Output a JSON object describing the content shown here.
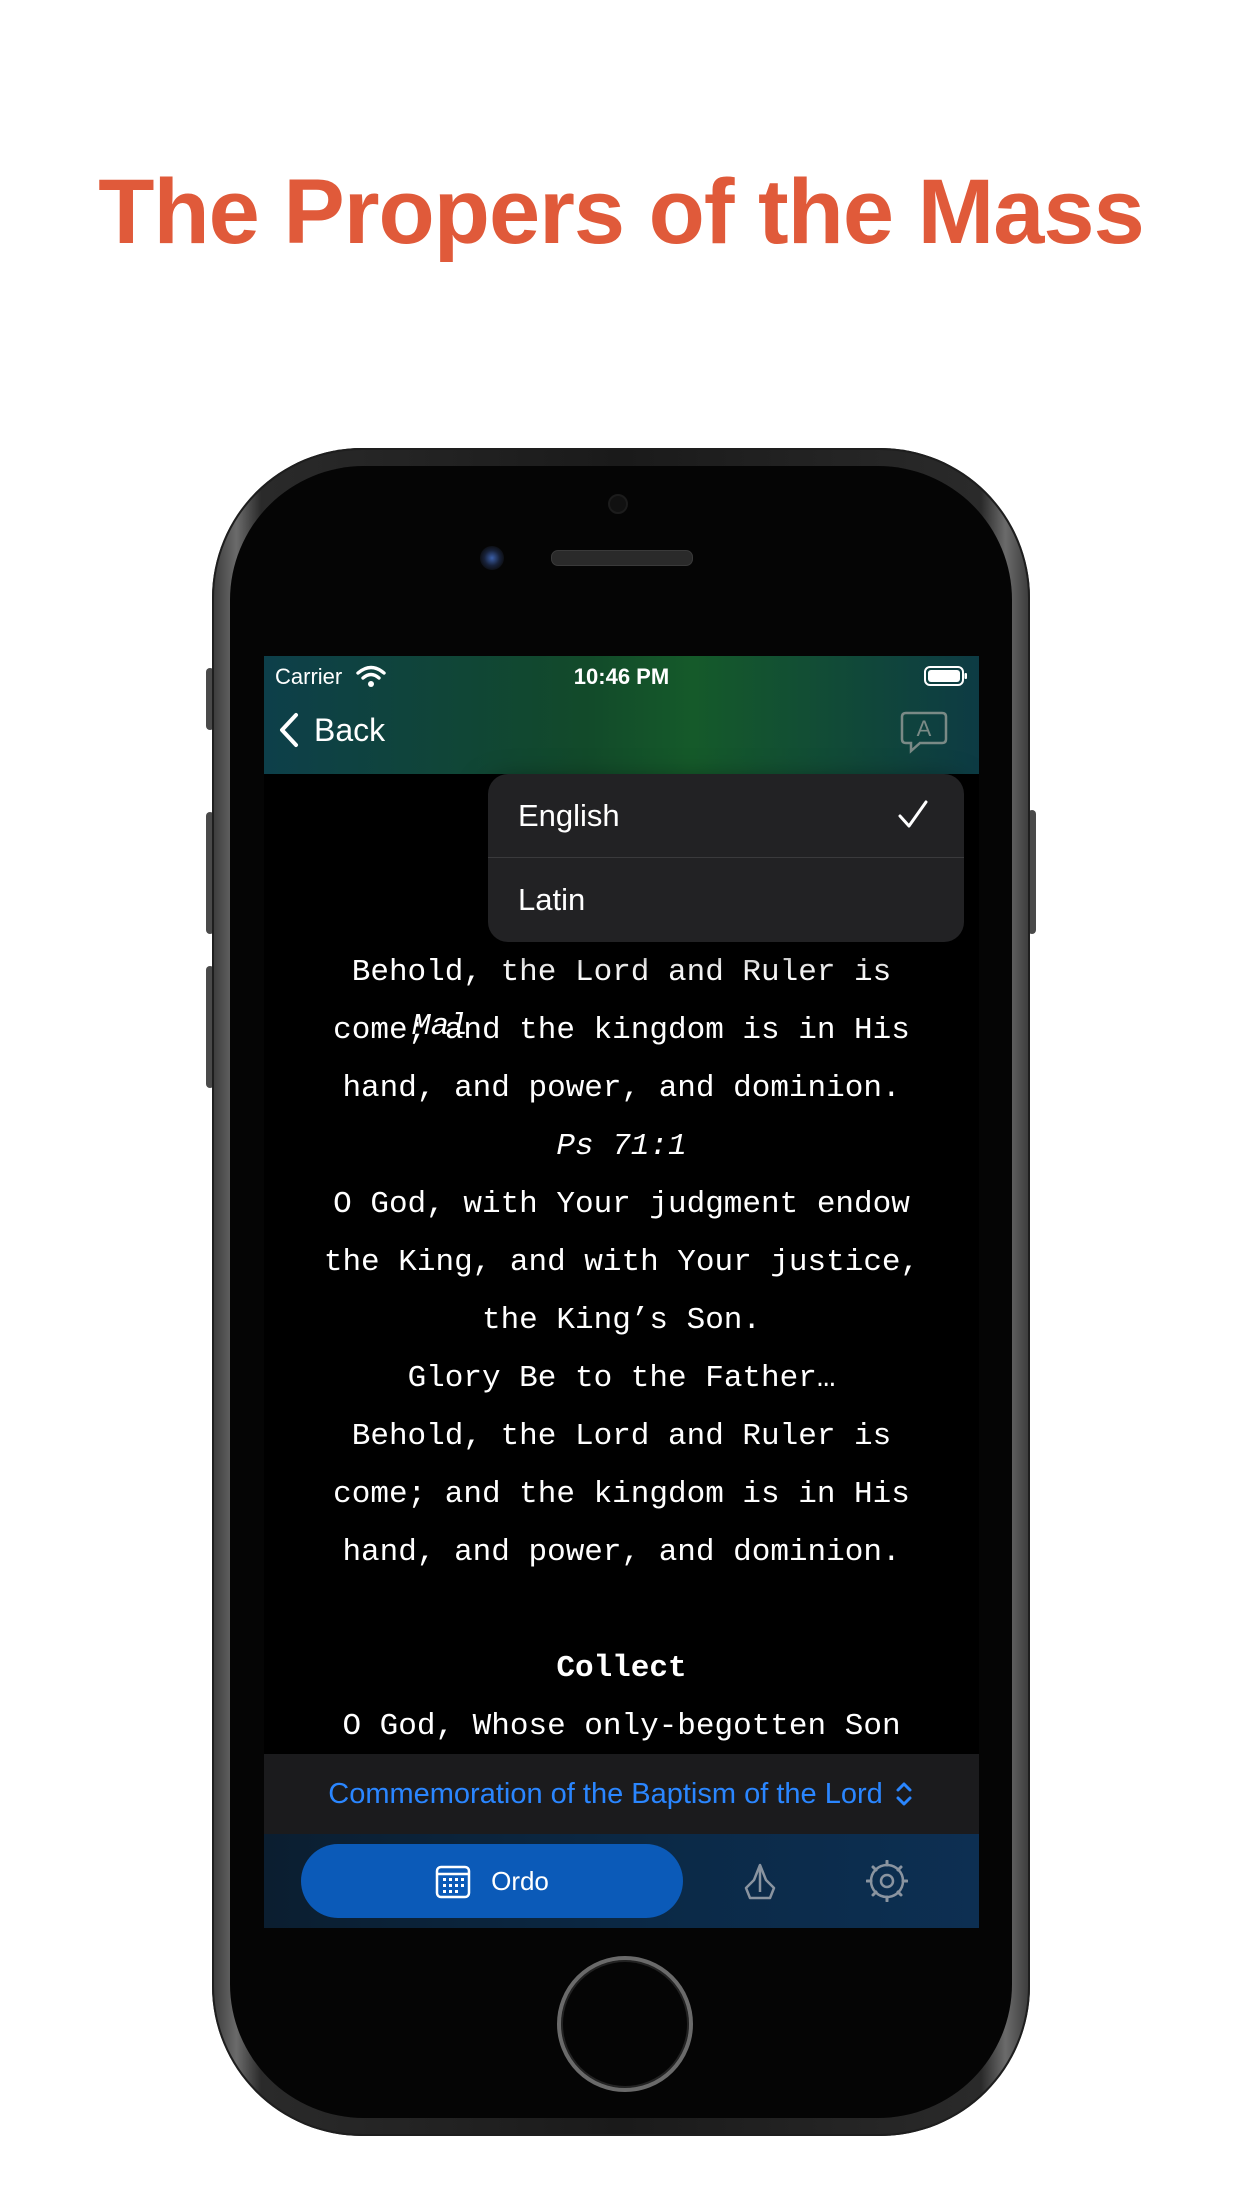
{
  "headline": "The Propers of the Mass",
  "status_bar": {
    "carrier": "Carrier",
    "time": "10:46 PM"
  },
  "navbar": {
    "back_label": "Back"
  },
  "language_menu": {
    "items": [
      {
        "label": "English",
        "selected": true
      },
      {
        "label": "Latin",
        "selected": false
      }
    ]
  },
  "content": {
    "ref_partial": "Mal",
    "lines": [
      "Behold, the Lord and Ruler is",
      "come; and the kingdom is in His",
      "hand, and power, and dominion.",
      "Ps 71:1",
      "O God, with Your judgment endow",
      "the King, and with Your justice,",
      "the King’s Son.",
      "Glory Be to the Father…",
      "Behold, the Lord and Ruler is",
      "come; and the kingdom is in His",
      "hand, and power, and dominion.",
      "",
      "Collect",
      "O God, Whose only-begotten Son"
    ]
  },
  "selector": {
    "label": "Commemoration of the Baptism of the Lord"
  },
  "tabbar": {
    "ordo_label": "Ordo"
  },
  "colors": {
    "headline": "#e05a3a",
    "accent_blue": "#2a86ff",
    "tab_active": "#0b5ab8"
  },
  "icons": [
    "wifi-icon",
    "battery-icon",
    "chevron-left-icon",
    "translate-icon",
    "checkmark-icon",
    "chevron-up-down-icon",
    "calendar-icon",
    "praying-hands-icon",
    "gear-icon"
  ]
}
